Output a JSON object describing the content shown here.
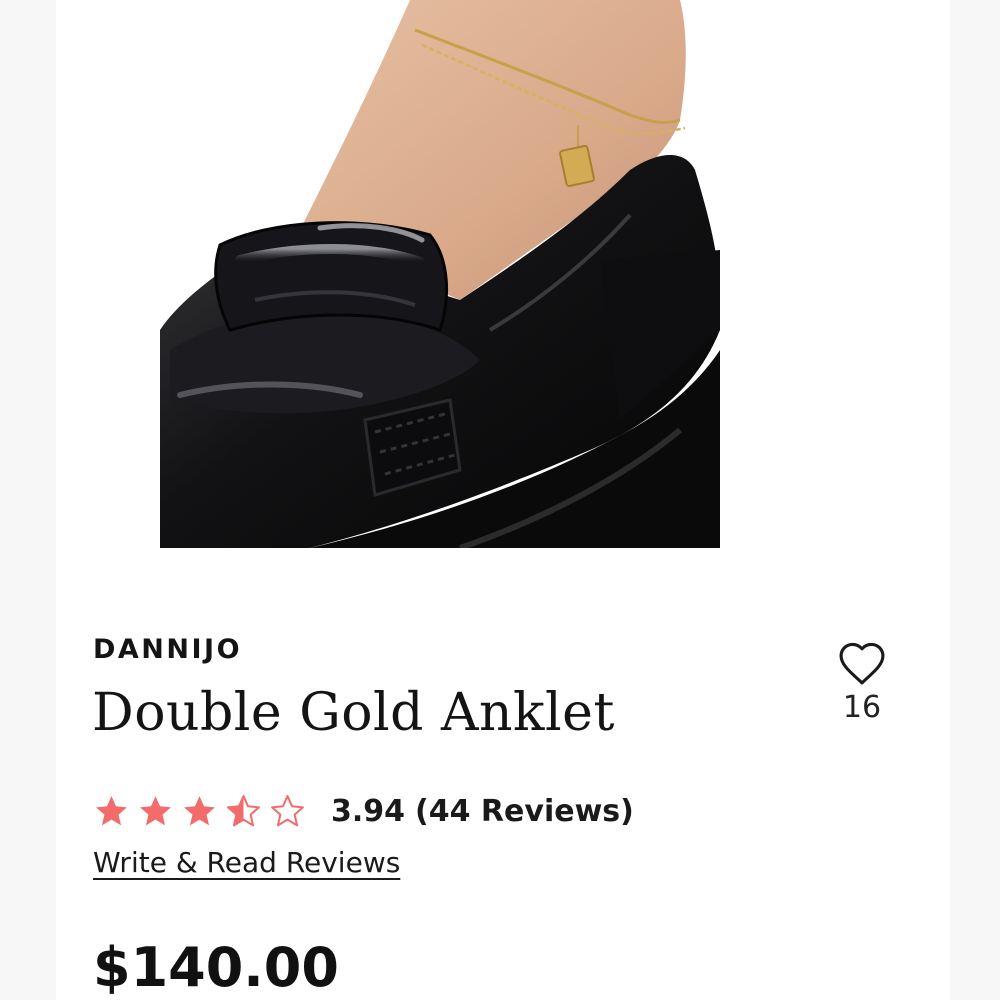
{
  "product": {
    "brand": "DANNIJO",
    "title": "Double Gold Anklet",
    "price": "$140.00",
    "image_alt": "Double Gold Anklet worn on ankle with black loafer"
  },
  "favorites": {
    "icon": "heart-outline-icon",
    "count": "16"
  },
  "rating": {
    "value": 3.94,
    "max": 5,
    "value_text": "3.94",
    "reviews_text": "(44 Reviews)",
    "star_color": "#f26c6c"
  },
  "reviews_link": {
    "label": "Write & Read Reviews"
  }
}
